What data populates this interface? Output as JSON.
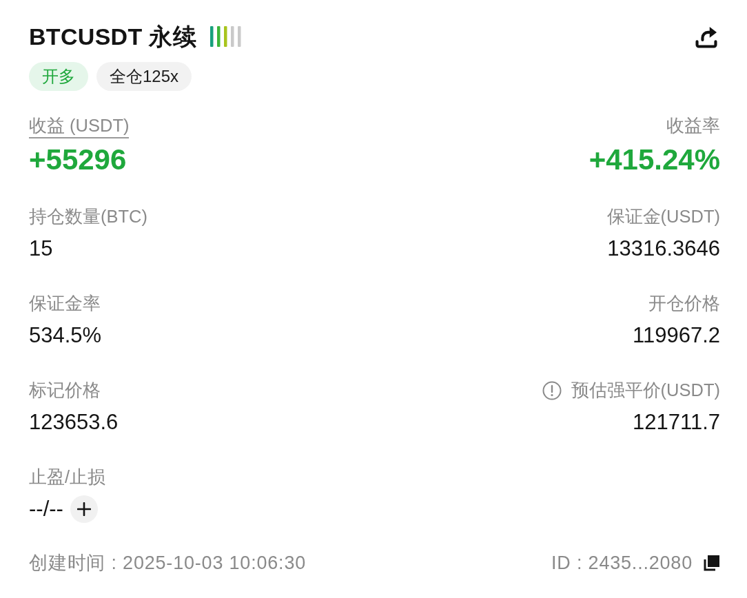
{
  "header": {
    "title": "BTCUSDT 永续"
  },
  "tags": [
    {
      "label": "开多",
      "kind": "side"
    },
    {
      "label": "全仓125x",
      "kind": "margin"
    }
  ],
  "metrics": [
    {
      "label": "收益 (USDT)",
      "value": "+55296",
      "kind": "profit",
      "underlined": true,
      "info": false
    },
    {
      "label": "收益率",
      "value": "+415.24%",
      "kind": "profit",
      "underlined": false,
      "info": false
    },
    {
      "label": "持仓数量(BTC)",
      "value": "15",
      "kind": "plain",
      "underlined": false,
      "info": false
    },
    {
      "label": "保证金(USDT)",
      "value": "13316.3646",
      "kind": "plain",
      "underlined": false,
      "info": false
    },
    {
      "label": "保证金率",
      "value": "534.5%",
      "kind": "plain",
      "underlined": false,
      "info": false
    },
    {
      "label": "开仓价格",
      "value": "119967.2",
      "kind": "plain",
      "underlined": false,
      "info": false
    },
    {
      "label": "标记价格",
      "value": "123653.6",
      "kind": "plain",
      "underlined": false,
      "info": false
    },
    {
      "label": "预估强平价(USDT)",
      "value": "121711.7",
      "kind": "plain",
      "underlined": false,
      "info": true
    },
    {
      "label": "止盈/止损",
      "value": "--/--",
      "kind": "editable",
      "underlined": false,
      "info": false
    }
  ],
  "footer": {
    "created": "创建时间 : 2025-10-03 10:06:30",
    "id": "ID : 2435...2080"
  }
}
